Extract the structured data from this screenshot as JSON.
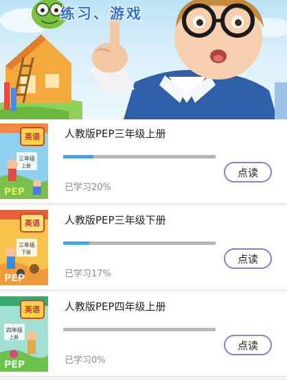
{
  "banner": {
    "title": "练习、游戏"
  },
  "books": [
    {
      "title": "人教版PEP三年级上册",
      "cover_label": "英语",
      "cover_grade": "三年级",
      "cover_term": "上册",
      "progress_text": "已学习20%",
      "progress_fraction": 0.2,
      "action_label": "点读"
    },
    {
      "title": "人教版PEP三年级下册",
      "cover_label": "英语",
      "cover_grade": "三年级",
      "cover_term": "下册",
      "progress_text": "已学习17%",
      "progress_fraction": 0.17,
      "action_label": "点读"
    },
    {
      "title": "人教版PEP四年级上册",
      "cover_label": "英语",
      "cover_grade": "四年级",
      "cover_term": "上册",
      "progress_text": "已学习0%",
      "progress_fraction": 0.0,
      "action_label": "点读"
    }
  ],
  "colors": {
    "progress_fill": "#49a4d6",
    "progress_track": "#b5b5b5",
    "button_border": "#8e79cf",
    "title_blue": "#2f74c9"
  }
}
